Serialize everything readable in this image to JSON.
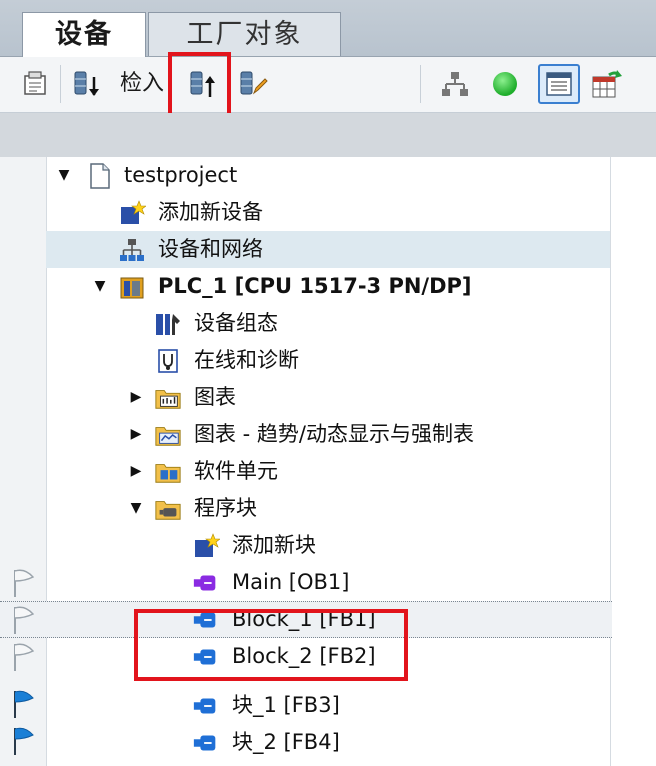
{
  "tabs": [
    {
      "label": "设备",
      "active": true
    },
    {
      "label": "工厂对象",
      "active": false
    }
  ],
  "toolbar": {
    "check_in_label": "检入"
  },
  "tree": {
    "items": [
      {
        "label": "testproject",
        "level": 0,
        "expanded": true,
        "icon": "project-icon"
      },
      {
        "label": "添加新设备",
        "level": 1,
        "icon": "add-device-icon"
      },
      {
        "label": "设备和网络",
        "level": 1,
        "icon": "network-icon",
        "selected": true
      },
      {
        "label": "PLC_1 [CPU 1517-3 PN/DP]",
        "level": 1,
        "expanded": true,
        "icon": "plc-icon"
      },
      {
        "label": "设备组态",
        "level": 2,
        "icon": "device-config-icon"
      },
      {
        "label": "在线和诊断",
        "level": 2,
        "icon": "diagnostics-icon"
      },
      {
        "label": "图表",
        "level": 2,
        "collapsed": true,
        "icon": "chart-folder-icon"
      },
      {
        "label": "图表 - 趋势/动态显示与强制表",
        "level": 2,
        "collapsed": true,
        "icon": "trend-folder-icon"
      },
      {
        "label": "软件单元",
        "level": 2,
        "collapsed": true,
        "icon": "software-unit-folder-icon"
      },
      {
        "label": "程序块",
        "level": 2,
        "expanded": true,
        "icon": "program-blocks-folder-icon"
      },
      {
        "label": "添加新块",
        "level": 3,
        "icon": "add-block-icon"
      },
      {
        "label": "Main [OB1]",
        "level": 3,
        "icon": "ob-block-icon",
        "flag": "outline"
      },
      {
        "label": "Block_1 [FB1]",
        "level": 3,
        "icon": "fb-block-icon",
        "flag": "outline"
      },
      {
        "label": "Block_2 [FB2]",
        "level": 3,
        "icon": "fb-block-icon",
        "flag": "outline"
      },
      {
        "label": "块_1 [FB3]",
        "level": 3,
        "icon": "fb-block-icon",
        "flag": "blue"
      },
      {
        "label": "块_2 [FB4]",
        "level": 3,
        "icon": "fb-block-icon",
        "flag": "blue"
      }
    ]
  },
  "colors": {
    "highlight_red": "#e2141c",
    "fb_blue": "#1f6fd6",
    "ob_purple": "#8a2be2",
    "flag_blue": "#1a7fd6",
    "status_green": "#2fc13b"
  }
}
